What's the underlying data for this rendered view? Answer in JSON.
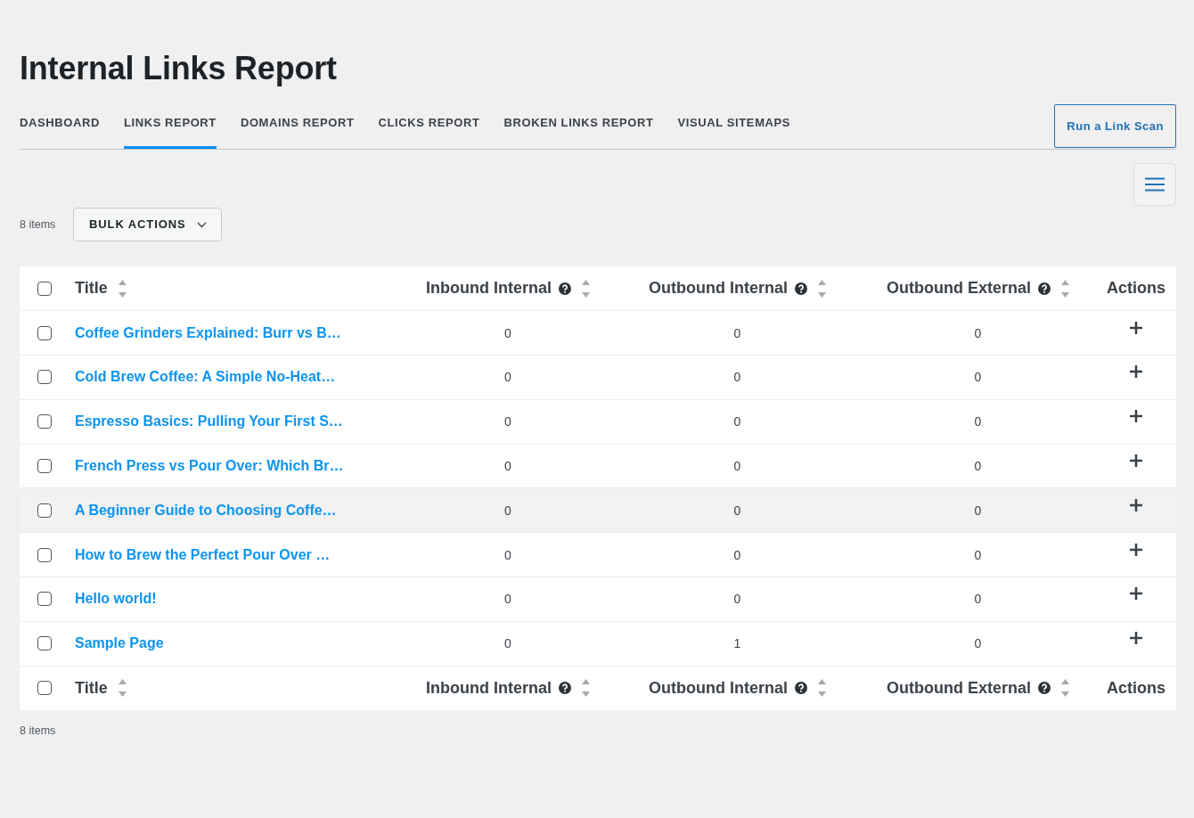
{
  "page": {
    "title": "Internal Links Report"
  },
  "tabs": [
    {
      "label": "DASHBOARD",
      "selected": false
    },
    {
      "label": "LINKS REPORT",
      "selected": true
    },
    {
      "label": "DOMAINS REPORT",
      "selected": false
    },
    {
      "label": "CLICKS REPORT",
      "selected": false
    },
    {
      "label": "BROKEN LINKS REPORT",
      "selected": false
    },
    {
      "label": "VISUAL SITEMAPS",
      "selected": false
    }
  ],
  "scan_button": {
    "label": "Run a Link Scan"
  },
  "toolbar_top": {
    "count": "8 items",
    "bulk_actions": {
      "label": "BULK ACTIONS"
    }
  },
  "table": {
    "header": {
      "checked": false,
      "columns": [
        {
          "label": "Title",
          "help": false,
          "sortable": true
        },
        {
          "label": "Inbound Internal",
          "help": true,
          "sortable": true
        },
        {
          "label": "Outbound Internal",
          "help": true,
          "sortable": true
        },
        {
          "label": "Outbound External",
          "help": true,
          "sortable": true
        },
        {
          "label": "Actions",
          "help": false,
          "sortable": false
        }
      ]
    },
    "rows": [
      {
        "checked": false,
        "hovered": false,
        "title": "Coffee Grinders Explained: Burr vs B…",
        "cells": [
          "0",
          "0",
          "0"
        ]
      },
      {
        "checked": false,
        "hovered": false,
        "title": "Cold Brew Coffee: A Simple No-Heat…",
        "cells": [
          "0",
          "0",
          "0"
        ]
      },
      {
        "checked": false,
        "hovered": false,
        "title": "Espresso Basics: Pulling Your First S…",
        "cells": [
          "0",
          "0",
          "0"
        ]
      },
      {
        "checked": false,
        "hovered": false,
        "title": "French Press vs Pour Over: Which Br…",
        "cells": [
          "0",
          "0",
          "0"
        ]
      },
      {
        "checked": false,
        "hovered": true,
        "title": "A Beginner Guide to Choosing Coffe…",
        "cells": [
          "0",
          "0",
          "0"
        ]
      },
      {
        "checked": false,
        "hovered": false,
        "title": "How to Brew the Perfect Pour Over …",
        "cells": [
          "0",
          "0",
          "0"
        ]
      },
      {
        "checked": false,
        "hovered": false,
        "title": "Hello world!",
        "cells": [
          "0",
          "0",
          "0"
        ]
      },
      {
        "checked": false,
        "hovered": false,
        "title": "Sample Page",
        "cells": [
          "0",
          "1",
          "0"
        ]
      }
    ],
    "footer": {
      "checked": false,
      "columns": [
        {
          "label": "Title",
          "help": false,
          "sortable": true
        },
        {
          "label": "Inbound Internal",
          "help": true,
          "sortable": true
        },
        {
          "label": "Outbound Internal",
          "help": true,
          "sortable": true
        },
        {
          "label": "Outbound External",
          "help": true,
          "sortable": true
        },
        {
          "label": "Actions",
          "help": false,
          "sortable": false
        }
      ]
    }
  },
  "toolbar_bottom": {
    "count": "8 items"
  }
}
